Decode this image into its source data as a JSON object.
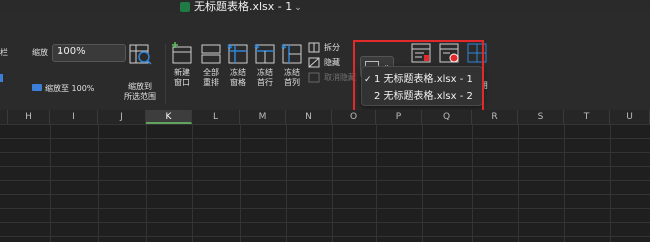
{
  "window": {
    "title": "无标题表格.xlsx - 1",
    "title_chevron": "⌄"
  },
  "ribbon": {
    "left_cut_label": "栏",
    "zoom_label": "缩放",
    "zoom_value": "100%",
    "zoom_to_100": "缩放至 100%",
    "zoom_to_selection": "缩放到\n所选范围",
    "buttons": [
      {
        "label": "新建\n窗口"
      },
      {
        "label": "全部\n重排"
      },
      {
        "label": "冻结\n窗格"
      },
      {
        "label": "冻结\n首行"
      },
      {
        "label": "冻结\n首列"
      }
    ],
    "split_label": "拆分",
    "hide_label": "隐藏",
    "unhide_label": "取消隐藏",
    "trailing_label": "用"
  },
  "switch_window_menu": {
    "items": [
      {
        "label": "1 无标题表格.xlsx  -  1",
        "checked": "✓"
      },
      {
        "label": "2 无标题表格.xlsx  -  2",
        "checked": ""
      }
    ]
  },
  "sheet": {
    "columns": [
      "H",
      "I",
      "J",
      "K",
      "L",
      "M",
      "N",
      "O",
      "P",
      "Q",
      "R",
      "S",
      "T",
      "U"
    ],
    "selected_column": "K"
  },
  "colors": {
    "highlight": "#e22a2a",
    "accent": "#2f85d6",
    "selection": "#5fa35f"
  }
}
